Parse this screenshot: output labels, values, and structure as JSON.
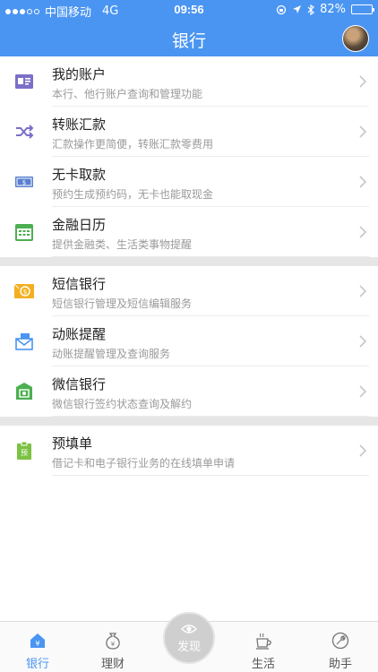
{
  "status": {
    "carrier": "中国移动",
    "network": "4G",
    "time": "09:56",
    "battery": "82%",
    "battery_level": 0.82
  },
  "header": {
    "title": "银行"
  },
  "menu": {
    "groups": [
      {
        "items": [
          {
            "label": "我的账户",
            "desc": "本行、他行账户查询和管理功能",
            "icon": "account-card-icon"
          },
          {
            "label": "转账汇款",
            "desc": "汇款操作更简便，转账汇款零费用",
            "icon": "shuffle-transfer-icon"
          },
          {
            "label": "无卡取款",
            "desc": "预约生成预约码，无卡也能取现金",
            "icon": "cash-note-icon"
          },
          {
            "label": "金融日历",
            "desc": "提供金融类、生活类事物提醒",
            "icon": "calendar-icon"
          }
        ]
      },
      {
        "items": [
          {
            "label": "短信银行",
            "desc": "短信银行管理及短信编辑服务",
            "icon": "sms-envelope-icon"
          },
          {
            "label": "动账提醒",
            "desc": "动账提醒管理及查询服务",
            "icon": "mail-alert-icon"
          },
          {
            "label": "微信银行",
            "desc": "微信银行签约状态查询及解约",
            "icon": "wechat-shield-icon"
          }
        ]
      },
      {
        "items": [
          {
            "label": "预填单",
            "desc": "借记卡和电子银行业务的在线填单申请",
            "icon": "clipboard-form-icon"
          }
        ]
      }
    ]
  },
  "tabbar": {
    "bank": "银行",
    "finance": "理财",
    "discover": "发现",
    "life": "生活",
    "assistant": "助手"
  },
  "colors": {
    "accent": "#4a95f2",
    "account": "#7b6fc9",
    "transfer": "#7b6fc9",
    "cash": "#5a7fd1",
    "calendar": "#4caf50",
    "sms": "#f2b021",
    "alert": "#4a95f2",
    "wechat": "#4caf50",
    "form": "#7cc242"
  }
}
